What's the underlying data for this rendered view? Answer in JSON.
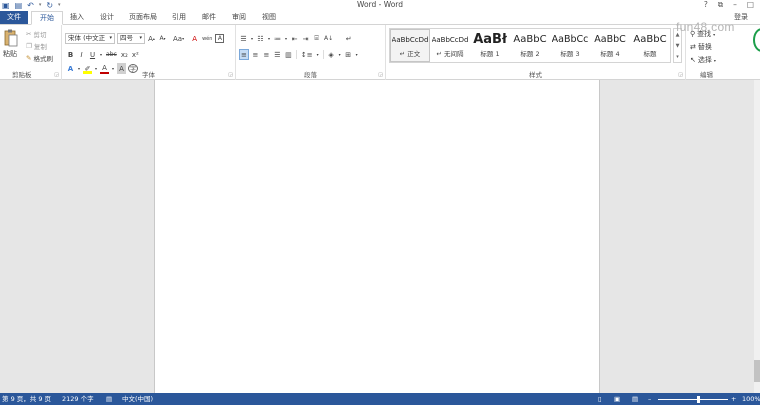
{
  "window": {
    "title": "Word - Word",
    "help": "?",
    "restore_ribbon": "⧉",
    "minimize": "–",
    "maximize": "□"
  },
  "qat": {
    "save_icon": "save-icon",
    "undo_icon": "undo-icon",
    "redo_icon": "redo-icon"
  },
  "tabs": [
    "文件",
    "开始",
    "插入",
    "设计",
    "页面布局",
    "引用",
    "邮件",
    "审阅",
    "视图"
  ],
  "login": "登录",
  "clipboard": {
    "paste": "粘贴",
    "cut": "剪切",
    "copy": "复制",
    "format_painter": "格式刷",
    "label": "剪贴板"
  },
  "font": {
    "name": "宋体 (中文正",
    "size": "四号",
    "grow": "A",
    "shrink": "A",
    "case": "Aa",
    "clear": "A",
    "phonetic": "wén",
    "border": "A",
    "bold": "B",
    "italic": "I",
    "underline": "U",
    "strike": "abc",
    "subscript": "x₂",
    "superscript": "x²",
    "label": "字体"
  },
  "paragraph": {
    "label": "段落"
  },
  "styles": {
    "label": "样式",
    "items": [
      {
        "sample": "AaBbCcDd",
        "name": "↵ 正文"
      },
      {
        "sample": "AaBbCcDd",
        "name": "↵ 无间隔"
      },
      {
        "sample": "AaBł",
        "name": "标题 1"
      },
      {
        "sample": "AaBbC",
        "name": "标题 2"
      },
      {
        "sample": "AaBbCc",
        "name": "标题 3"
      },
      {
        "sample": "AaBbC",
        "name": "标题 4"
      },
      {
        "sample": "AaBbC",
        "name": "标题"
      }
    ]
  },
  "editing": {
    "find": "查找",
    "replace": "替换",
    "select": "选择",
    "label": "编辑"
  },
  "status": {
    "page": "第 9 页，共 9 页",
    "words": "2129 个字",
    "language": "中文(中国)",
    "zoom": "100%"
  },
  "watermark": "fun48.com",
  "colors": {
    "accent": "#2b579a",
    "highlight": "#ffff00",
    "font_color": "#c00000"
  }
}
